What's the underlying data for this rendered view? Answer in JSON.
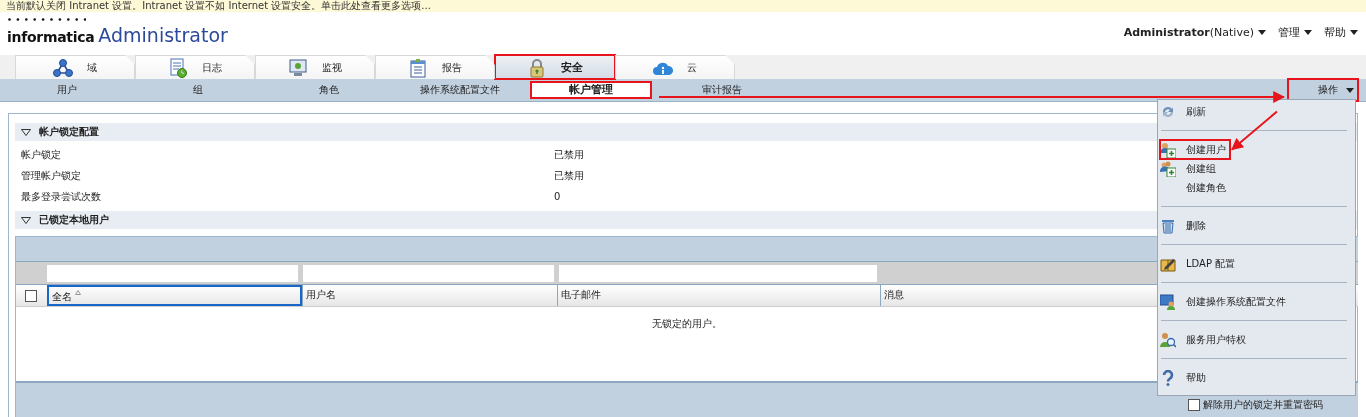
{
  "notice": "当前默认关闭 Intranet 设置。Intranet 设置不如 Internet 设置安全。单击此处查看更多选项...",
  "logo": {
    "brand": "informatica",
    "product": "Administrator"
  },
  "user_menu": [
    {
      "label": "**Administrator**(Native)"
    },
    {
      "label": "管理"
    },
    {
      "label": "帮助"
    }
  ],
  "tabs": [
    {
      "label": "域",
      "selected": false,
      "highlighted": false
    },
    {
      "label": "日志",
      "selected": false,
      "highlighted": false
    },
    {
      "label": "监视",
      "selected": false,
      "highlighted": false
    },
    {
      "label": "报告",
      "selected": false,
      "highlighted": false
    },
    {
      "label": "安全",
      "selected": true,
      "highlighted": true
    },
    {
      "label": "云",
      "selected": false,
      "highlighted": false
    }
  ],
  "subtabs": [
    {
      "label": "用户",
      "selected": false,
      "highlighted": false
    },
    {
      "label": "组",
      "selected": false,
      "highlighted": false
    },
    {
      "label": "角色",
      "selected": false,
      "highlighted": false
    },
    {
      "label": "操作系统配置文件",
      "selected": false,
      "highlighted": false
    },
    {
      "label": "帐户管理",
      "selected": true,
      "highlighted": true
    },
    {
      "label": "审计报告",
      "selected": false,
      "highlighted": false
    }
  ],
  "actions_button": {
    "label": "操作",
    "highlighted": true,
    "arrow_pointing": true
  },
  "sections": [
    {
      "title": "帐户锁定配置",
      "expanded": true,
      "rows": [
        {
          "label": "帐户锁定",
          "value": "已禁用"
        },
        {
          "label": "管理帐户锁定",
          "value": "已禁用"
        },
        {
          "label": "最多登录尝试次数",
          "value": "0"
        }
      ]
    },
    {
      "title": "已锁定本地用户",
      "expanded": true
    }
  ],
  "table": {
    "select_all_checked": false,
    "columns": [
      {
        "label": "全名",
        "sorted": true,
        "focused": true
      },
      {
        "label": "用户名",
        "sorted": false,
        "focused": false
      },
      {
        "label": "电子邮件",
        "sorted": false,
        "focused": false
      },
      {
        "label": "消息",
        "sorted": false,
        "focused": false
      }
    ],
    "empty_message": "无锁定的用户。"
  },
  "footer_checkbox": {
    "label": "解除用户的锁定并重置密码",
    "checked": false
  },
  "menu": [
    {
      "kind": "item",
      "label": "刷新",
      "highlighted": false,
      "arrow_pointing": false
    },
    {
      "kind": "separator"
    },
    {
      "kind": "item",
      "label": "创建用户",
      "highlighted": true,
      "arrow_pointing": true
    },
    {
      "kind": "item",
      "label": "创建组",
      "highlighted": false,
      "arrow_pointing": false
    },
    {
      "kind": "item",
      "label": "创建角色",
      "highlighted": false,
      "arrow_pointing": false
    },
    {
      "kind": "separator"
    },
    {
      "kind": "item",
      "label": "删除",
      "highlighted": false,
      "arrow_pointing": false
    },
    {
      "kind": "separator"
    },
    {
      "kind": "item",
      "label": "LDAP 配置",
      "highlighted": false,
      "arrow_pointing": false
    },
    {
      "kind": "separator"
    },
    {
      "kind": "item",
      "label": "创建操作系统配置文件",
      "highlighted": false,
      "arrow_pointing": false
    },
    {
      "kind": "separator"
    },
    {
      "kind": "item",
      "label": "服务用户特权",
      "highlighted": false,
      "arrow_pointing": false
    },
    {
      "kind": "separator"
    },
    {
      "kind": "item",
      "label": "帮助",
      "highlighted": false,
      "arrow_pointing": false
    }
  ]
}
